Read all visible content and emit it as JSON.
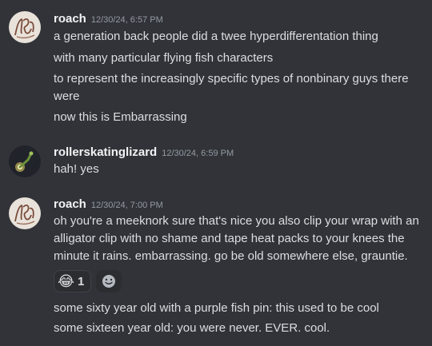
{
  "messages": [
    {
      "author": "roach",
      "timestamp": "12/30/24, 6:57 PM",
      "lines": [
        "a generation back people did a twee hyperdifferentation thing",
        "with many particular flying fish characters",
        "to represent the increasingly specific types of nonbinary guys there were",
        "now this is Embarrassing"
      ]
    },
    {
      "author": "rollerskatinglizard",
      "timestamp": "12/30/24, 6:59 PM",
      "lines": [
        "hah! yes"
      ]
    },
    {
      "author": "roach",
      "timestamp": "12/30/24, 7:00 PM",
      "lines": [
        "oh you're a meeknork sure that's nice you also clip your wrap with an alligator clip with no shame and tape heat packs to your knees the minute it rains. embarrassing. go be old somewhere else, grauntie."
      ],
      "reactions": [
        {
          "emoji": "😂",
          "count": "1"
        }
      ],
      "followups": [
        "some sixty year old with a purple fish pin: this used to be cool",
        "some sixteen year old: you were never. EVER. cool."
      ]
    }
  ],
  "icons": {
    "avatar_roach": "roach-avatar-icon",
    "avatar_lizard": "lizard-avatar-icon",
    "add_reaction": "add-reaction-icon"
  },
  "colors": {
    "background": "#313338",
    "text": "#dbdee1",
    "author": "#f2f3f5",
    "timestamp": "#949ba4"
  }
}
